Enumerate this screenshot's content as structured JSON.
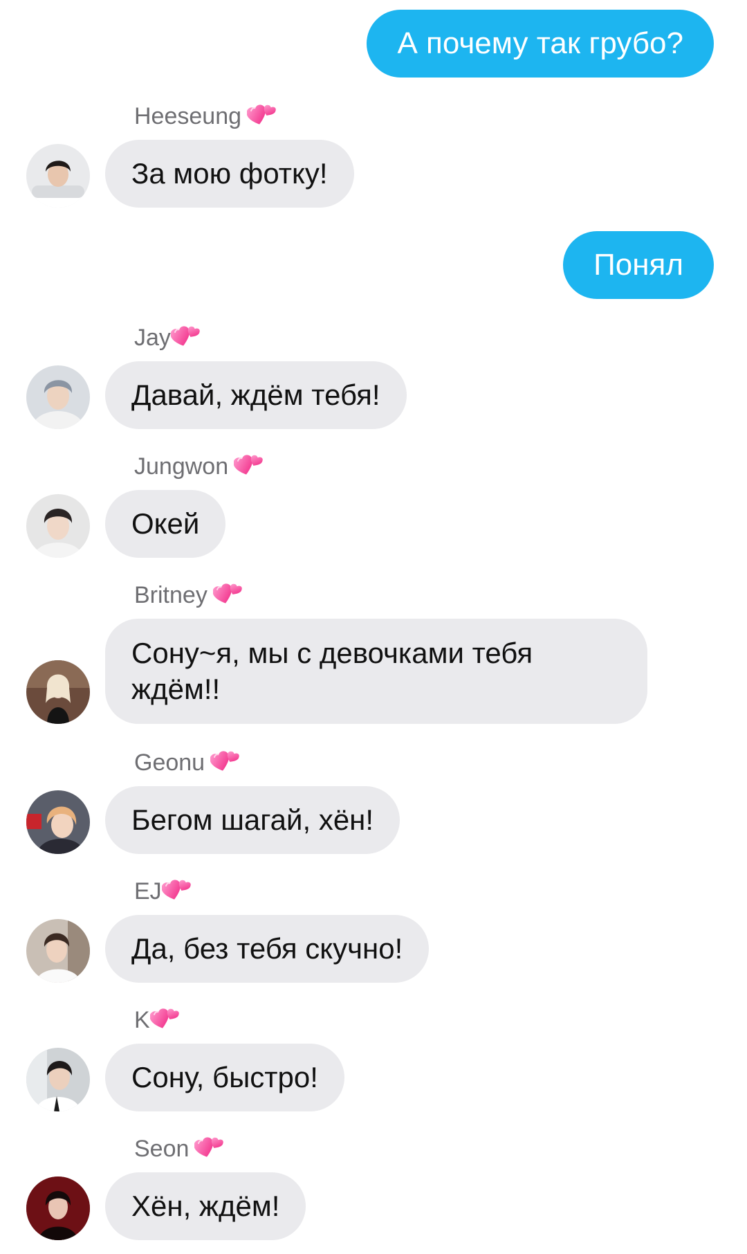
{
  "chat": {
    "outgoing": [
      {
        "text": "А почему так грубо?"
      },
      {
        "text": "Понял"
      }
    ],
    "incoming": [
      {
        "sender": "Heeseung",
        "text": "За мою фотку!"
      },
      {
        "sender": "Jay",
        "text": "Давай, ждём тебя!"
      },
      {
        "sender": "Jungwon",
        "text": "Окей"
      },
      {
        "sender": "Britney",
        "text": "Сону~я, мы с девочками тебя ждём!!"
      },
      {
        "sender": "Geonu",
        "text": "Бегом шагай, хён!"
      },
      {
        "sender": "EJ",
        "text": "Да, без тебя скучно!"
      },
      {
        "sender": "K",
        "text": "Сону, быстро!"
      },
      {
        "sender": "Seon",
        "text": "Хён, ждём!"
      }
    ]
  },
  "colors": {
    "outgoing_bubble": "#1db5f0",
    "incoming_bubble": "#eaeaed",
    "sender_name": "#6e6e72",
    "heart": "#ff4fa0"
  },
  "icons": {
    "sender_badge": "two-hearts-icon"
  }
}
